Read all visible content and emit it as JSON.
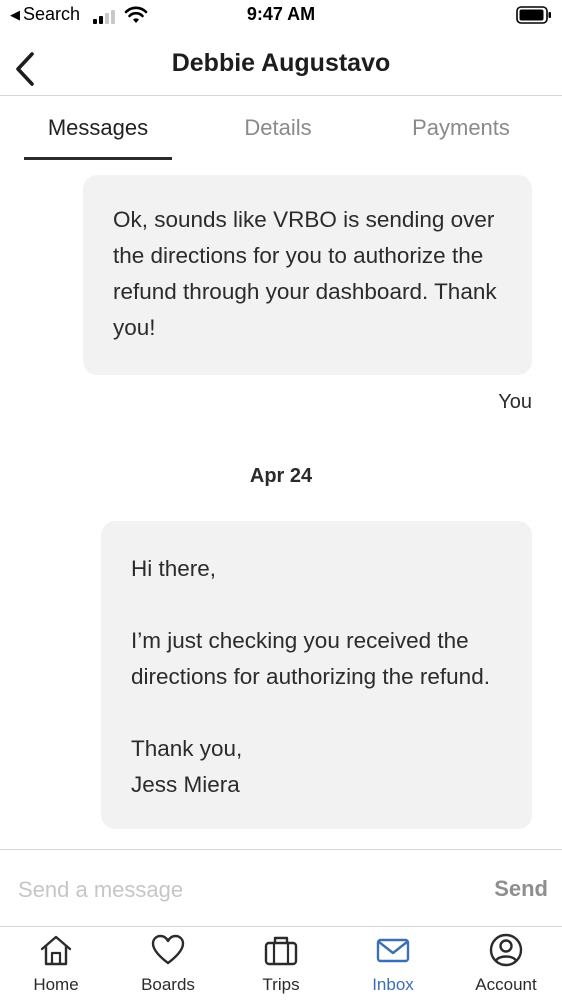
{
  "status_bar": {
    "back_label": "Search",
    "time": "9:47 AM"
  },
  "header": {
    "title": "Debbie Augustavo"
  },
  "tabs": [
    {
      "label": "Messages",
      "active": true
    },
    {
      "label": "Details",
      "active": false
    },
    {
      "label": "Payments",
      "active": false
    }
  ],
  "messages": [
    {
      "text": "Ok, sounds like VRBO is sending over\nthe directions for you to authorize the\nrefund through your dashboard. Thank\nyou!",
      "sender": "You"
    },
    {
      "date_divider": "Apr 24",
      "text": "Hi there,\n\nI’m just checking you received the\ndirections for authorizing the refund.\n\nThank you,\nJess Miera"
    }
  ],
  "composer": {
    "placeholder": "Send a message",
    "value": "",
    "send_label": "Send"
  },
  "bottom_nav": [
    {
      "label": "Home",
      "icon": "home-icon",
      "active": false
    },
    {
      "label": "Boards",
      "icon": "heart-icon",
      "active": false
    },
    {
      "label": "Trips",
      "icon": "suitcase-icon",
      "active": false
    },
    {
      "label": "Inbox",
      "icon": "envelope-icon",
      "active": true
    },
    {
      "label": "Account",
      "icon": "account-icon",
      "active": false
    }
  ],
  "colors": {
    "accent": "#3b6fb6",
    "bubble": "#f2f2f2",
    "text": "#2b2b2b",
    "muted": "#8a8a8a"
  }
}
